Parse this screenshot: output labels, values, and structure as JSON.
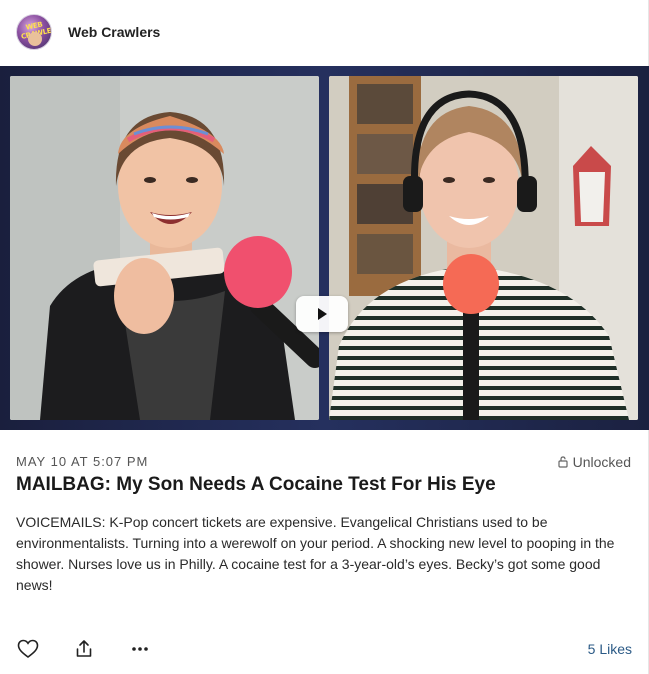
{
  "header": {
    "channel_name": "Web Crawlers",
    "avatar_text": "WEB CRAWLERS"
  },
  "video": {
    "play_icon": "play-icon"
  },
  "post": {
    "date": "MAY 10 AT 5:07 PM",
    "access_label": "Unlocked",
    "access_icon": "lock-open-icon",
    "title": "MAILBAG: My Son Needs A Cocaine Test For His Eye",
    "description": "VOICEMAILS: K-Pop concert tickets are expensive. Evangelical Christians used to be environmentalists. Turning into a werewolf on your period. A shocking new level to pooping in the shower. Nurses love us in Philly. A cocaine test for a 3-year-old’s eyes. Becky’s got some good news!"
  },
  "actions": {
    "like_icon": "heart-icon",
    "share_icon": "share-icon",
    "more_icon": "more-horizontal-icon",
    "likes_label": "5 Likes"
  },
  "colors": {
    "video_bg": "#1f274a",
    "link": "#2b5a86",
    "mic": "#f0506e"
  }
}
